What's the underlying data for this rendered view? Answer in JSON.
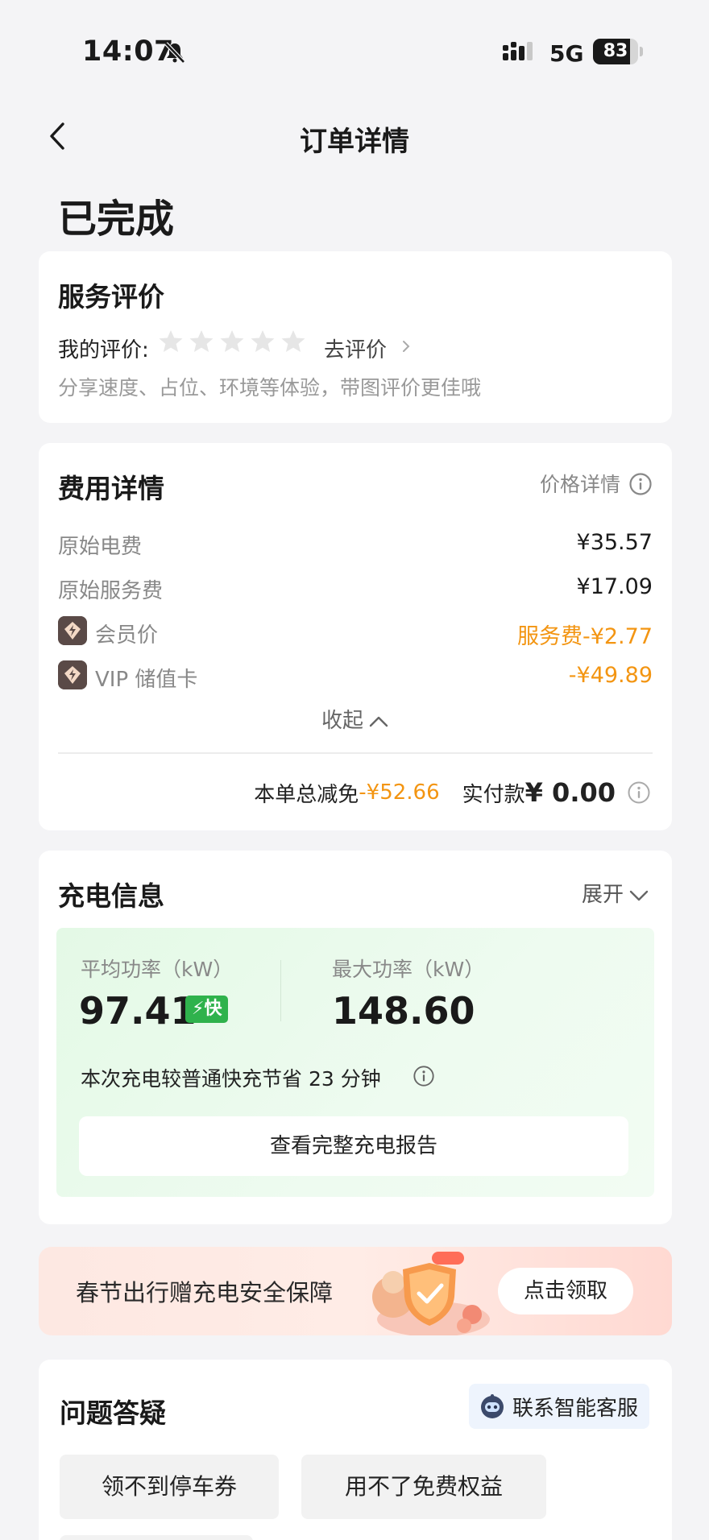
{
  "status_bar": {
    "time": "14:07",
    "network": "5G",
    "battery": "83",
    "battery_level": 0.83
  },
  "nav": {
    "title": "订单详情"
  },
  "order_status": "已完成",
  "review": {
    "title": "服务评价",
    "my_label": "我的评价:",
    "rating": 0,
    "max_rating": 5,
    "go_label": "去评价",
    "hint": "分享速度、占位、环境等体验，带图评价更佳哦"
  },
  "cost": {
    "title": "费用详情",
    "price_detail_label": "价格详情",
    "rows": [
      {
        "label": "原始电费",
        "value": "¥35.57"
      },
      {
        "label": "原始服务费",
        "value": "¥17.09"
      },
      {
        "label": "会员价",
        "value": "服务费-¥2.77"
      },
      {
        "label": "VIP 储值卡",
        "value": "-¥49.89"
      }
    ],
    "collapse_label": "收起",
    "total_discount_label": "本单总减免",
    "total_discount_value": "-¥52.66",
    "paid_label": "实付款",
    "paid_value": "¥ 0.00"
  },
  "charging": {
    "title": "充电信息",
    "expand_label": "展开",
    "avg_power_label": "平均功率（kW）",
    "avg_power_value": "97.41",
    "fast_badge": "快",
    "max_power_label": "最大功率（kW）",
    "max_power_value": "148.60",
    "saving_text": "本次充电较普通快充节省 23 分钟",
    "report_button": "查看完整充电报告"
  },
  "promo": {
    "text": "春节出行赠充电安全保障",
    "claim_button": "点击领取"
  },
  "faq": {
    "title": "问题答疑",
    "contact_label": "联系智能客服",
    "chips": [
      "领不到停车券",
      "用不了免费权益"
    ]
  },
  "colors": {
    "accent_orange": "#f39512",
    "fast_green": "#2fb24c",
    "panel_green": "#e4f9e6"
  }
}
